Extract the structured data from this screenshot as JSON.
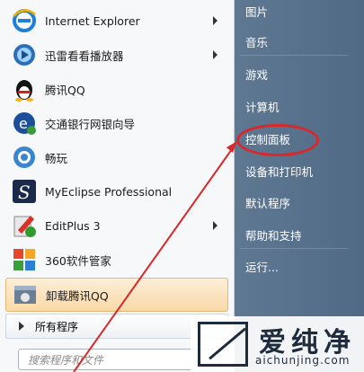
{
  "left_menu": {
    "items": [
      {
        "label": "Internet Explorer",
        "icon": "ie-icon",
        "has_submenu": true
      },
      {
        "label": "迅雷看看播放器",
        "icon": "xunlei-player-icon",
        "has_submenu": true
      },
      {
        "label": "腾讯QQ",
        "icon": "qq-icon",
        "has_submenu": false
      },
      {
        "label": "交通银行网银向导",
        "icon": "bank-guide-icon",
        "has_submenu": false
      },
      {
        "label": "畅玩",
        "icon": "changwan-icon",
        "has_submenu": false
      },
      {
        "label": "MyEclipse Professional",
        "icon": "myeclipse-icon",
        "has_submenu": false
      },
      {
        "label": "EditPlus 3",
        "icon": "editplus-icon",
        "has_submenu": true
      },
      {
        "label": "360软件管家",
        "icon": "360-software-icon",
        "has_submenu": false
      },
      {
        "label": "卸载腾讯QQ",
        "icon": "uninstall-qq-icon",
        "has_submenu": false
      }
    ],
    "all_programs": "所有程序",
    "search_placeholder": "搜索程序和文件"
  },
  "right_menu": {
    "items": [
      "图片",
      "音乐",
      "游戏",
      "计算机",
      "控制面板",
      "设备和打印机",
      "默认程序",
      "帮助和支持",
      "运行..."
    ]
  },
  "annotation": {
    "color": "#d8282a",
    "highlighted": "控制面板"
  },
  "watermark": {
    "brand": "爱纯净",
    "url": "aichunjing.com"
  }
}
